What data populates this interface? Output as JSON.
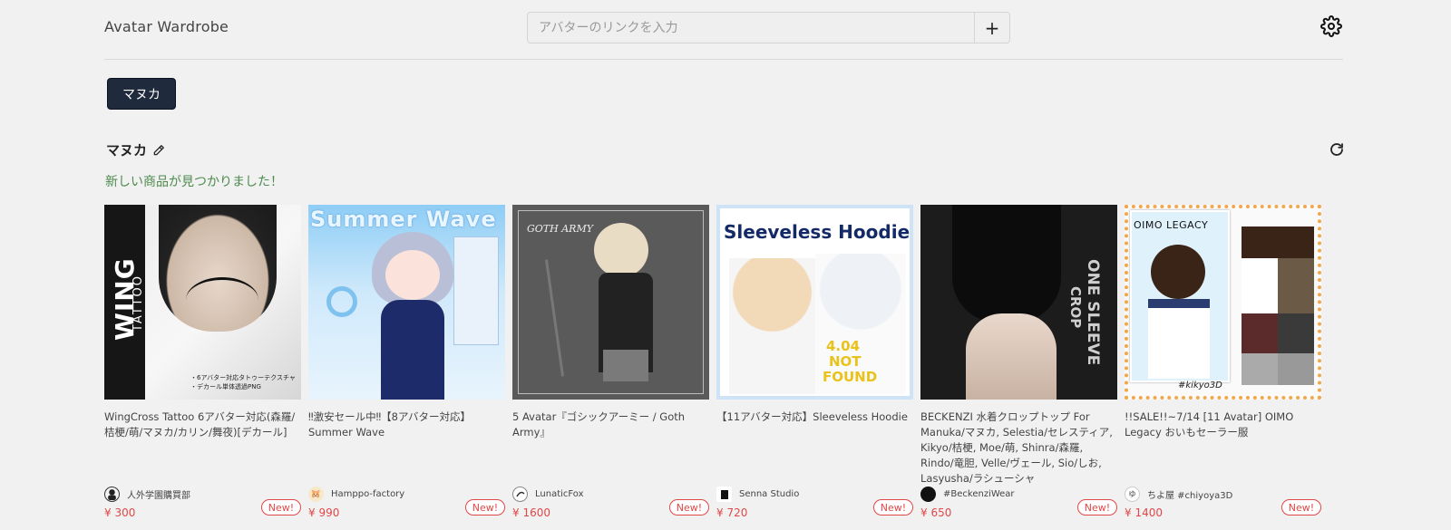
{
  "header": {
    "title": "Avatar Wardrobe",
    "url_placeholder": "アバターのリンクを入力",
    "add_label": "+"
  },
  "tabs": [
    {
      "label": "マヌカ"
    }
  ],
  "section": {
    "title": "マヌカ",
    "status": "新しい商品が見つかりました！"
  },
  "products": [
    {
      "title": "WingCross Tattoo 6アバター対応(森羅/桔梗/萌/マヌカ/カリン/舞夜)[デカール]",
      "seller": "人外学園購買部",
      "price": "¥ 300",
      "badge": "New!",
      "thumb_text": [
        "WING",
        "TATTOO",
        "・6アバター対応タトゥーテクスチャ",
        "・デカール単体透過PNG"
      ]
    },
    {
      "title": "‼激安セール中‼【8アバター対応】Summer Wave",
      "seller": "Hamppo-factory",
      "price": "¥ 990",
      "badge": "New!",
      "thumb_text": [
        "Summer Wave"
      ]
    },
    {
      "title": "5 Avatar『ゴシックアーミー / Goth Army』",
      "seller": "LunaticFox",
      "price": "¥ 1600",
      "badge": "New!",
      "thumb_text": [
        "GOTH ARMY"
      ]
    },
    {
      "title": "【11アバター対応】Sleeveless Hoodie",
      "seller": "Senna Studio",
      "price": "¥ 720",
      "badge": "New!",
      "thumb_text": [
        "Sleeveless Hoodie",
        "4.04",
        "NOT",
        "FOUND"
      ]
    },
    {
      "title": "BECKENZI 水着クロップトップ For Manuka/マヌカ, Selestia/セレスティア, Kikyo/桔梗, Moe/萌, Shinra/森羅, Rindo/竜胆, Velle/ヴェール, Sio/しお, Lasyusha/ラシューシャ",
      "seller": "#BeckenziWear",
      "price": "¥ 650",
      "badge": "New!",
      "thumb_text": [
        "ONE SLEEVE",
        "CROP"
      ]
    },
    {
      "title": "!!SALE!!~7/14 [11 Avatar] OIMO Legacy おいもセーラー服",
      "seller": "ちよ屋 #chiyoya3D",
      "price": "¥ 1400",
      "badge": "New!",
      "thumb_text": [
        "OIMO LEGACY",
        "#kikyo3D"
      ]
    }
  ],
  "colors": {
    "background": "#f1f1f1",
    "tab_active": "#1f2a3d",
    "price": "#e04848",
    "status": "#4d8a4d"
  }
}
